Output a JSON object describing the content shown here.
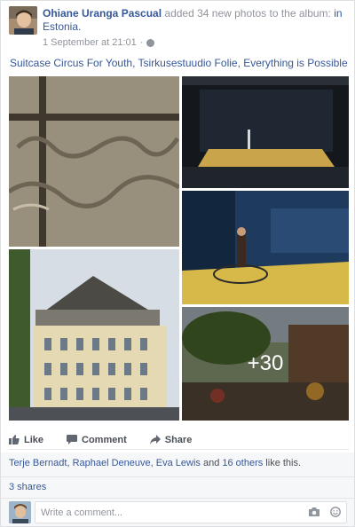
{
  "post": {
    "author": "Ohiane Uranga Pascual",
    "action_text": " added 34 new photos to the album: ",
    "album_link": "in",
    "location": "Estonia.",
    "timestamp": "1 September at 21:01",
    "meta_separator": "·",
    "caption": "Suitcase Circus For Youth, Tsirkusestuudio Folie, Everything is Possible",
    "more_photos": "+30"
  },
  "actions": {
    "like": "Like",
    "comment": "Comment",
    "share": "Share"
  },
  "likes": {
    "names": [
      "Terje Bernadt",
      "Raphael Deneuve",
      "Eva Lewis"
    ],
    "sep": ", ",
    "and": " and ",
    "others": "16 others",
    "suffix": " like this."
  },
  "shares": "3 shares",
  "comment_box": {
    "placeholder": "Write a comment..."
  },
  "icons": [
    "globe-icon",
    "thumbs-up-icon",
    "comment-icon",
    "share-arrow-icon",
    "camera-icon",
    "smiley-icon"
  ],
  "colors": {
    "link": "#365899",
    "meta": "#90949c",
    "bg": "#f6f7f9"
  }
}
